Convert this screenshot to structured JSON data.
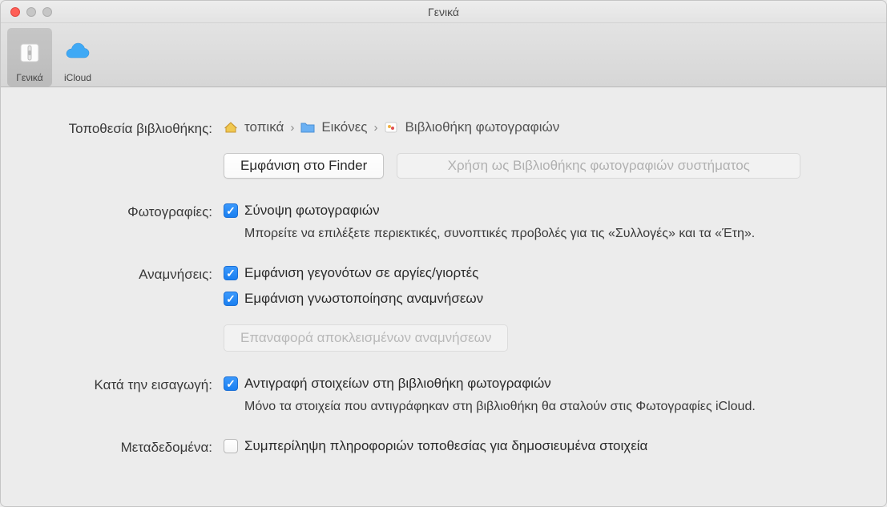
{
  "window": {
    "title": "Γενικά"
  },
  "toolbar": {
    "general": {
      "label": "Γενικά"
    },
    "icloud": {
      "label": "iCloud"
    }
  },
  "location": {
    "label": "Τοποθεσία βιβλιοθήκης:",
    "breadcrumb": {
      "home": "τοπικά",
      "pictures": "Εικόνες",
      "library": "Βιβλιοθήκη φωτογραφιών"
    },
    "show_in_finder": "Εμφάνιση στο Finder",
    "use_as_system": "Χρήση ως Βιβλιοθήκης φωτογραφιών συστήματος"
  },
  "photos": {
    "label": "Φωτογραφίες:",
    "summarize_label": "Σύνοψη φωτογραφιών",
    "summarize_help": "Μπορείτε να επιλέξετε περιεκτικές, συνοπτικές προβολές για τις «Συλλογές» και τα «Έτη»."
  },
  "memories": {
    "label": "Αναμνήσεις:",
    "holiday_label": "Εμφάνιση γεγονότων σε αργίες/γιορτές",
    "notification_label": "Εμφάνιση γνωστοποίησης αναμνήσεων",
    "reset_button": "Επαναφορά αποκλεισμένων αναμνήσεων"
  },
  "importing": {
    "label": "Κατά την εισαγωγή:",
    "copy_label": "Αντιγραφή στοιχείων στη βιβλιοθήκη φωτογραφιών",
    "copy_help": "Μόνο τα στοιχεία που αντιγράφηκαν στη βιβλιοθήκη θα σταλούν στις Φωτογραφίες iCloud."
  },
  "metadata": {
    "label": "Μεταδεδομένα:",
    "include_location_label": "Συμπερίληψη πληροφοριών τοποθεσίας για δημοσιευμένα στοιχεία"
  }
}
